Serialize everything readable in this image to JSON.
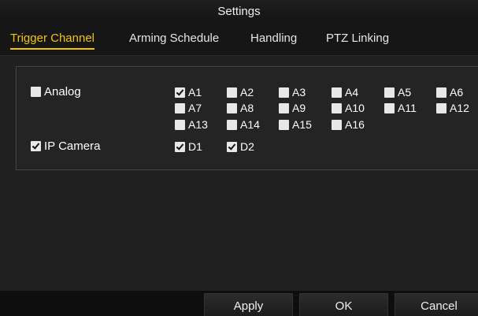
{
  "window": {
    "title": "Settings"
  },
  "tabs": [
    {
      "label": "Trigger Channel",
      "active": true
    },
    {
      "label": "Arming Schedule",
      "active": false
    },
    {
      "label": "Handling",
      "active": false
    },
    {
      "label": "PTZ Linking",
      "active": false
    }
  ],
  "analog": {
    "label": "Analog",
    "checked": false,
    "channels": [
      {
        "label": "A1",
        "checked": true
      },
      {
        "label": "A2",
        "checked": false
      },
      {
        "label": "A3",
        "checked": false
      },
      {
        "label": "A4",
        "checked": false
      },
      {
        "label": "A5",
        "checked": false
      },
      {
        "label": "A6",
        "checked": false
      },
      {
        "label": "A7",
        "checked": false
      },
      {
        "label": "A8",
        "checked": false
      },
      {
        "label": "A9",
        "checked": false
      },
      {
        "label": "A10",
        "checked": false
      },
      {
        "label": "A11",
        "checked": false
      },
      {
        "label": "A12",
        "checked": false
      },
      {
        "label": "A13",
        "checked": false
      },
      {
        "label": "A14",
        "checked": false
      },
      {
        "label": "A15",
        "checked": false
      },
      {
        "label": "A16",
        "checked": false
      }
    ]
  },
  "ip_camera": {
    "label": "IP Camera",
    "checked": true,
    "channels": [
      {
        "label": "D1",
        "checked": true
      },
      {
        "label": "D2",
        "checked": true
      }
    ]
  },
  "buttons": {
    "apply": "Apply",
    "ok": "OK",
    "cancel": "Cancel"
  },
  "colors": {
    "active_tab": "#f5c400",
    "background": "#202020",
    "checkbox": "#e8e8e8"
  }
}
